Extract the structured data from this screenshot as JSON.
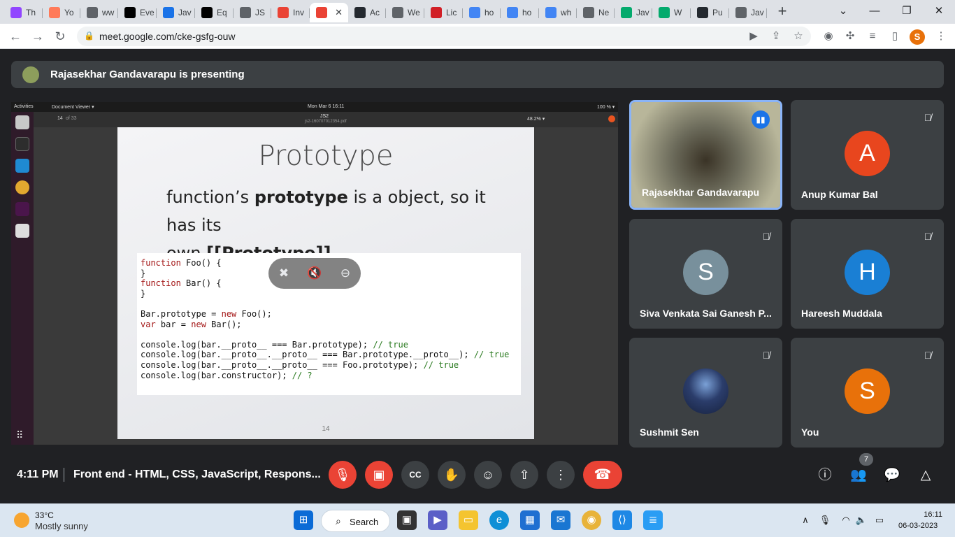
{
  "browser": {
    "tabs": [
      {
        "label": "Th",
        "icon": "twitch-icon",
        "color": "#9146ff"
      },
      {
        "label": "Yo",
        "icon": "hubspot-icon",
        "color": "#ff7a59"
      },
      {
        "label": "ww",
        "icon": "globe-icon",
        "color": "#5f6368"
      },
      {
        "label": "Eve",
        "icon": "medium-icon",
        "color": "#000000"
      },
      {
        "label": "Jav",
        "icon": "loading-icon",
        "color": "#1a73e8"
      },
      {
        "label": "Eq",
        "icon": "medium-icon",
        "color": "#000000"
      },
      {
        "label": "JS",
        "icon": "globe-icon",
        "color": "#5f6368"
      },
      {
        "label": "Inv",
        "icon": "gmail-icon",
        "color": "#ea4335"
      },
      {
        "label": "",
        "icon": "recording-icon",
        "color": "#ea4335",
        "active": true
      },
      {
        "label": "Ac",
        "icon": "github-icon",
        "color": "#24292f"
      },
      {
        "label": "We",
        "icon": "globe-icon",
        "color": "#5f6368"
      },
      {
        "label": "Lic",
        "icon": "hdfc-icon",
        "color": "#d11f26"
      },
      {
        "label": "ho",
        "icon": "google-icon",
        "color": "#4285f4"
      },
      {
        "label": "ho",
        "icon": "google-icon",
        "color": "#4285f4"
      },
      {
        "label": "wh",
        "icon": "google-icon",
        "color": "#4285f4"
      },
      {
        "label": "Ne",
        "icon": "chatgpt-icon",
        "color": "#5f6368"
      },
      {
        "label": "Jav",
        "icon": "w3schools-icon",
        "color": "#04aa6d"
      },
      {
        "label": "W",
        "icon": "w3schools-icon",
        "color": "#04aa6d"
      },
      {
        "label": "Pu",
        "icon": "github-icon",
        "color": "#24292f"
      },
      {
        "label": "Jav",
        "icon": "globe-icon",
        "color": "#5f6368"
      }
    ],
    "url": "meet.google.com/cke-gsfg-ouw",
    "profile_initial": "S"
  },
  "meet": {
    "presenter_banner": "Rajasekhar Gandavarapu is presenting",
    "shared_screen": {
      "topbar_left1": "Activities",
      "topbar_left2": "Document Viewer ▾",
      "topbar_center": "Mon Mar 6  16:11",
      "topbar_right": "100 % ▾",
      "doc_title": "JS2",
      "doc_subtitle": "js2-160707012354.pdf",
      "page_num": "14",
      "page_total": "of 33",
      "zoom": "48.2% ▾",
      "slide_title": "Prototype",
      "slide_line1_pre": "function’s ",
      "slide_line1_bold": "prototype",
      "slide_line1_post": " is a object, so it has its",
      "slide_line2_pre": "own ",
      "slide_line2_bold": "[[Prototype]]",
      "slide_page": "14"
    },
    "participants": [
      {
        "name": "Rajasekhar Gandavarapu",
        "speaking": true
      },
      {
        "name": "Anup Kumar Bal",
        "initial": "A",
        "color": "#e8461e"
      },
      {
        "name": "Siva Venkata Sai Ganesh P...",
        "initial": "S",
        "color": "#78909c"
      },
      {
        "name": "Hareesh Muddala",
        "initial": "H",
        "color": "#1a7fd4"
      },
      {
        "name": "Sushmit Sen"
      },
      {
        "name": "You",
        "initial": "S",
        "color": "#e8710a"
      }
    ],
    "time": "4:11 PM",
    "meeting_name": "Front end - HTML, CSS, JavaScript, Respons...",
    "people_count": "7"
  },
  "taskbar": {
    "temperature": "33°C",
    "condition": "Mostly sunny",
    "search_label": "Search",
    "clock": "16:11",
    "date": "06-03-2023"
  }
}
